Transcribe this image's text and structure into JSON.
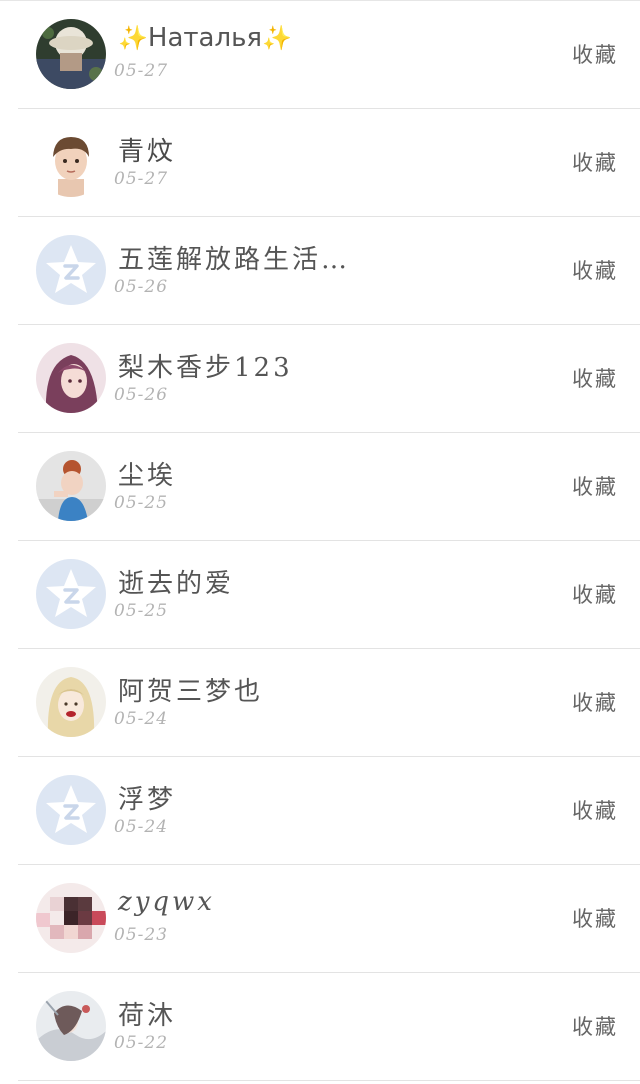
{
  "list": {
    "items": [
      {
        "name": "Наталья",
        "date": "05-27",
        "action": "收藏",
        "avatar": "photo-hat-icon"
      },
      {
        "name": "青炆",
        "date": "05-27",
        "action": "收藏",
        "avatar": "cartoon-boy-icon"
      },
      {
        "name": "五莲解放路生活…",
        "date": "05-26",
        "action": "收藏",
        "avatar": "default-qzone-star-icon"
      },
      {
        "name": "梨木香步123",
        "date": "05-26",
        "action": "收藏",
        "avatar": "anime-girl-icon"
      },
      {
        "name": "尘埃",
        "date": "05-25",
        "action": "收藏",
        "avatar": "photo-girl-icon"
      },
      {
        "name": "逝去的爱",
        "date": "05-25",
        "action": "收藏",
        "avatar": "default-qzone-star-icon"
      },
      {
        "name": "阿贺三梦也",
        "date": "05-24",
        "action": "收藏",
        "avatar": "blonde-girl-icon"
      },
      {
        "name": "浮梦",
        "date": "05-24",
        "action": "收藏",
        "avatar": "default-qzone-star-icon"
      },
      {
        "name": "zyqwx",
        "date": "05-23",
        "action": "收藏",
        "avatar": "pixelated-photo-icon"
      },
      {
        "name": "荷沐",
        "date": "05-22",
        "action": "收藏",
        "avatar": "illustration-icon"
      }
    ]
  },
  "colors": {
    "sparkle": "#f0d978",
    "default_avatar_bg": "#dde6f3",
    "default_avatar_star": "#ffffff"
  }
}
